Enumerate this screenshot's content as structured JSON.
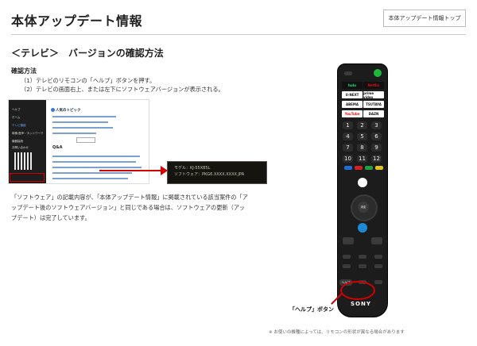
{
  "header": {
    "title": "本体アップデート情報",
    "top_button": "本体アップデート情報トップ"
  },
  "section": {
    "title": "＜テレビ＞　バージョンの確認方法",
    "method_label": "確認方法",
    "steps": [
      "（1）テレビのリモコンの「ヘルプ」ボタンを押す。",
      "（2）テレビの画面右上、または左下にソフトウェアバージョンが表示される。"
    ],
    "paragraph": "「ソフトウェア」の記載内容が、「本体アップデート情報」に掲載されている該当案件の「アップデート後のソフトウェアバージョン」と同じである場合は、ソフトウェアの更新（アップデート）は完了しています。"
  },
  "help_screen": {
    "sidebar_items": [
      "ヘルプ",
      "ホーム",
      "テレビ機能",
      "映像/音声・ネットワーク",
      "機器接続",
      "お問い合わせ"
    ],
    "popular_title": "人気のトピック",
    "qa_title": "Q&A"
  },
  "version_screen": {
    "model": "モデル：KJ-55X85L",
    "software": "ソフトウェア：PKG6.XXXX.XXXX.JPA"
  },
  "remote": {
    "apps": [
      "hulu",
      "Netflix",
      "U-NEXT",
      "prime video",
      "ABEMA",
      "TSUTAYA",
      "YouTube",
      "DAZN"
    ],
    "numbers": [
      "1",
      "2",
      "3",
      "4",
      "5",
      "6",
      "7",
      "8",
      "9",
      "10",
      "11",
      "12"
    ],
    "enter_label": "決定",
    "help_label": "ヘルプ",
    "brand": "SONY"
  },
  "help_button_label": "「ヘルプ」ボタン",
  "note": "※ お使いの機種によっては、リモコンの形状が異なる場合があります",
  "colors": {
    "accent": "#d40000",
    "power": "#1fb83a"
  }
}
